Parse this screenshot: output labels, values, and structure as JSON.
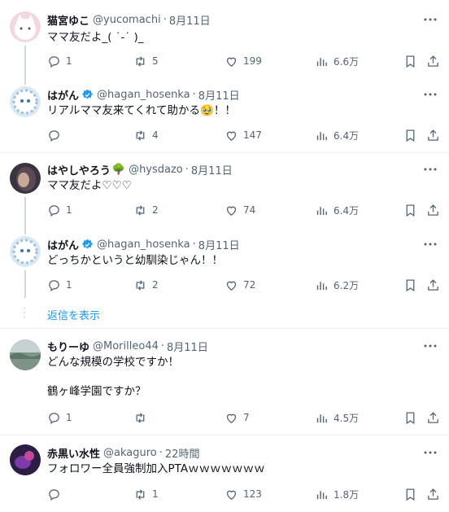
{
  "tweets": [
    {
      "name": "猫宮ゆこ",
      "handle": "@yucomachi",
      "time": "8月11日",
      "text": "ママ友だよ_( ˙-˙ )_",
      "reply": "1",
      "retweet": "5",
      "like": "199",
      "views": "6.6万",
      "avatar_color": "#f2d9e0"
    },
    {
      "name": "はがん",
      "handle": "@hagan_hosenka",
      "time": "8月11日",
      "text": "リアルママ友来てくれて助かる🥹！！",
      "reply": "",
      "retweet": "4",
      "like": "147",
      "views": "6.4万",
      "verified": true,
      "avatar_color": "#dbe9f3"
    },
    {
      "name": "はやしやろう",
      "handle": "@hysdazo",
      "time": "8月11日",
      "text": "ママ友だよ♡♡♡",
      "reply": "1",
      "retweet": "2",
      "like": "74",
      "views": "6.4万",
      "avatar_color": "#3a3440",
      "tree_emoji": "🌳"
    },
    {
      "name": "はがん",
      "handle": "@hagan_hosenka",
      "time": "8月11日",
      "text": "どっちかというと幼馴染じゃん！！",
      "reply": "1",
      "retweet": "2",
      "like": "72",
      "views": "6.2万",
      "verified": true,
      "avatar_color": "#dbe9f3"
    },
    {
      "name": "もりーゆ",
      "handle": "@Morilleo44",
      "time": "8月11日",
      "text": "どんな規模の学校ですか！",
      "text2": "鶴ヶ峰学園ですか？",
      "reply": "1",
      "retweet": "",
      "like": "7",
      "views": "4.5万",
      "avatar_color": "#9bb1a6"
    },
    {
      "name": "赤黒い水性",
      "handle": "@akaguro",
      "time": "22時間",
      "text": "フォロワー全員強制加入PTAｗｗｗｗｗｗｗ",
      "reply": "",
      "retweet": "1",
      "like": "123",
      "views": "1.8万",
      "avatar_color": "#3c2a5a"
    }
  ],
  "show_replies": "返信を表示",
  "colors": {
    "text": "#0f1419",
    "muted": "#536471",
    "blue": "#1d9bf0",
    "border": "#eff3f4"
  }
}
